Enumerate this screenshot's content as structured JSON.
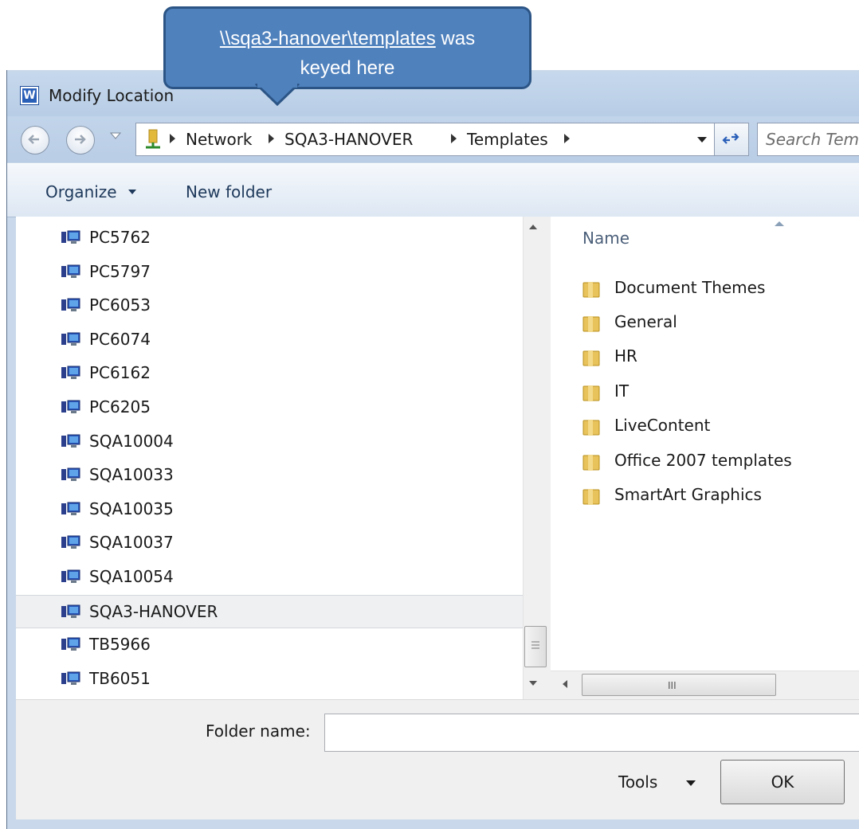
{
  "window": {
    "title": "Modify Location",
    "app_icon_letter": "W"
  },
  "address_bar": {
    "crumbs": [
      "Network",
      "SQA3-HANOVER",
      "Templates"
    ],
    "search_placeholder": "Search Templates"
  },
  "toolbar": {
    "organize_label": "Organize",
    "new_folder_label": "New folder"
  },
  "nav_pane": {
    "items": [
      {
        "label": "PC5762"
      },
      {
        "label": "PC5797"
      },
      {
        "label": "PC6053"
      },
      {
        "label": "PC6074"
      },
      {
        "label": "PC6162"
      },
      {
        "label": "PC6205"
      },
      {
        "label": "SQA10004"
      },
      {
        "label": "SQA10033"
      },
      {
        "label": "SQA10035"
      },
      {
        "label": "SQA10037"
      },
      {
        "label": "SQA10054"
      },
      {
        "label": "SQA3-HANOVER",
        "selected": true
      },
      {
        "label": "TB5966"
      },
      {
        "label": "TB6051"
      }
    ]
  },
  "file_pane": {
    "column_header": "Name",
    "items": [
      {
        "label": "Document Themes"
      },
      {
        "label": "General"
      },
      {
        "label": "HR"
      },
      {
        "label": "IT"
      },
      {
        "label": "LiveContent"
      },
      {
        "label": "Office 2007 templates"
      },
      {
        "label": "SmartArt Graphics"
      }
    ]
  },
  "footer": {
    "folder_name_label": "Folder name:",
    "folder_name_value": "",
    "tools_label": "Tools",
    "ok_label": "OK"
  },
  "callout": {
    "link_text": "\\\\sqa3-hanover\\templates",
    "text_after_link": " was",
    "line2": "keyed here"
  },
  "colors": {
    "callout_fill": "#4f81bd",
    "frame_blue": "#c9d8ea",
    "folder_yellow": "#e8c25a"
  }
}
